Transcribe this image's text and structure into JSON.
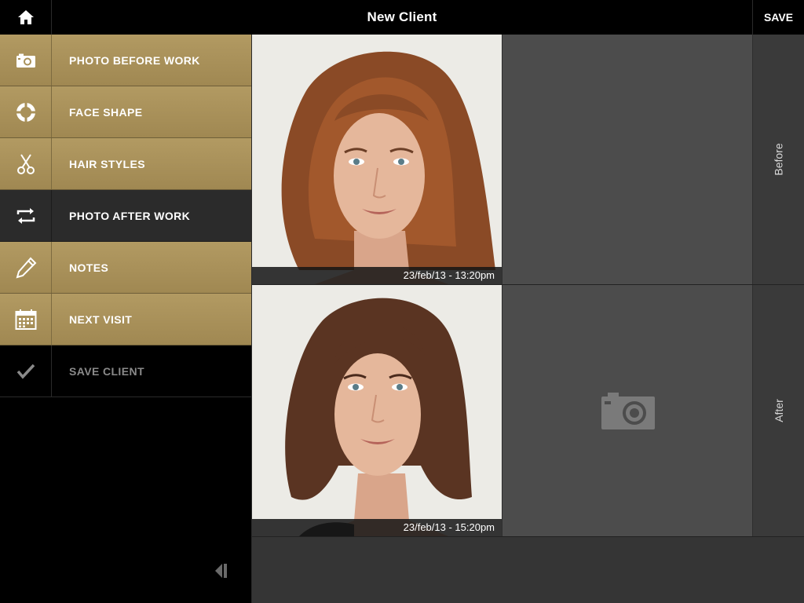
{
  "header": {
    "title": "New Client",
    "save_label": "SAVE",
    "home_icon": "home-icon"
  },
  "sidebar": {
    "items": [
      {
        "label": "PHOTO BEFORE WORK",
        "icon": "camera-icon",
        "state": "normal"
      },
      {
        "label": "FACE SHAPE",
        "icon": "face-shape-icon",
        "state": "normal"
      },
      {
        "label": "HAIR STYLES",
        "icon": "scissors-icon",
        "state": "normal"
      },
      {
        "label": "PHOTO AFTER WORK",
        "icon": "swap-arrows-icon",
        "state": "active"
      },
      {
        "label": "NOTES",
        "icon": "pencil-icon",
        "state": "normal"
      },
      {
        "label": "NEXT VISIT",
        "icon": "calendar-icon",
        "state": "normal"
      },
      {
        "label": "SAVE CLIENT",
        "icon": "checkmark-icon",
        "state": "disabled"
      }
    ],
    "collapse_icon": "collapse-left-icon"
  },
  "photos": {
    "before": {
      "timestamp": "23/feb/13 - 13:20pm",
      "tab_label": "Before"
    },
    "after": {
      "timestamp": "23/feb/13 - 15:20pm",
      "tab_label": "After",
      "empty_slot_icon": "camera-icon"
    }
  },
  "colors": {
    "menu_gold": "#a99159",
    "menu_active": "#2b2b2b",
    "background": "#000000",
    "content_bg": "#353535",
    "slot_bg": "#4c4c4c"
  }
}
